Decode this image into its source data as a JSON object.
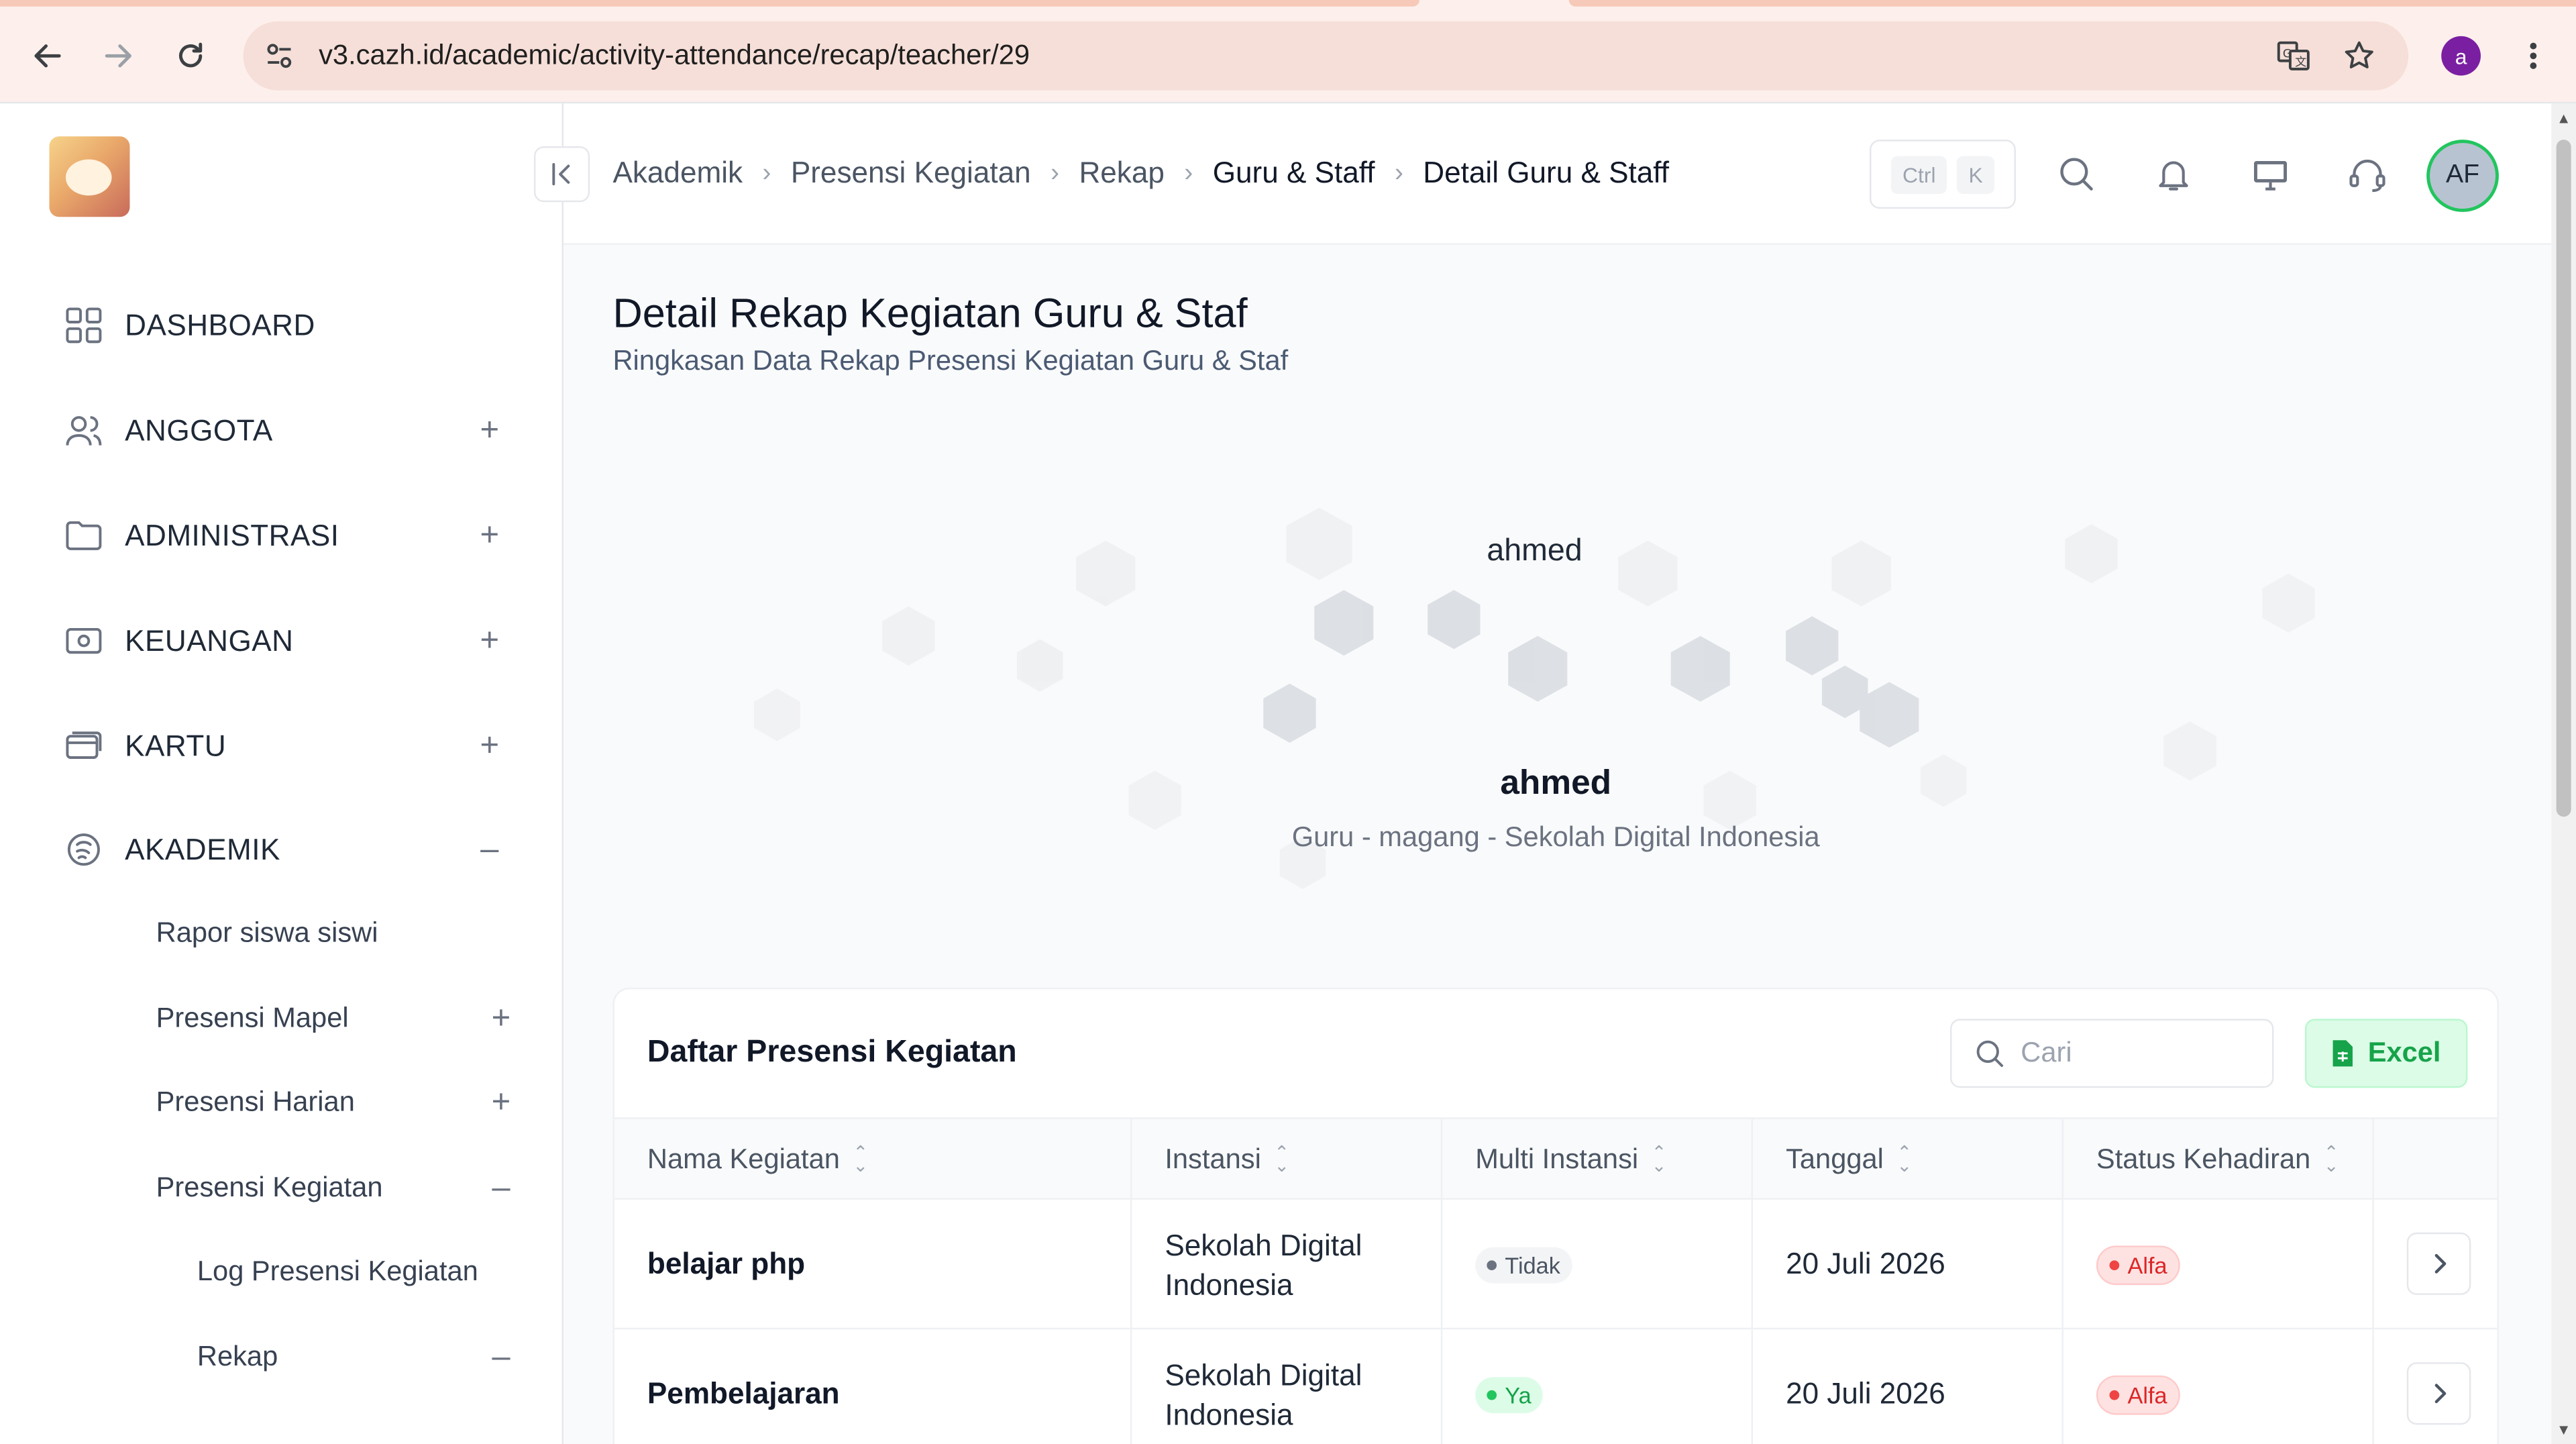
{
  "browser": {
    "url": "v3.cazh.id/academic/activity-attendance/recap/teacher/29",
    "profile_initial": "a"
  },
  "sidebar": {
    "menu": [
      {
        "label": "DASHBOARD",
        "icon": "grid-icon",
        "toggle": ""
      },
      {
        "label": "ANGGOTA",
        "icon": "users-icon",
        "toggle": "+"
      },
      {
        "label": "ADMINISTRASI",
        "icon": "folder-icon",
        "toggle": "+"
      },
      {
        "label": "KEUANGAN",
        "icon": "money-icon",
        "toggle": "+"
      },
      {
        "label": "KARTU",
        "icon": "card-icon",
        "toggle": "+"
      },
      {
        "label": "AKADEMIK",
        "icon": "academic-icon",
        "toggle": "–"
      }
    ],
    "submenu": [
      {
        "label": "Rapor siswa siswi",
        "toggle": ""
      },
      {
        "label": "Presensi Mapel",
        "toggle": "+"
      },
      {
        "label": "Presensi Harian",
        "toggle": "+"
      },
      {
        "label": "Presensi Kegiatan",
        "toggle": "–"
      },
      {
        "label": "Log Presensi Kegiatan",
        "toggle": ""
      },
      {
        "label": "Rekap",
        "toggle": "–"
      }
    ]
  },
  "header": {
    "breadcrumb": [
      "Akademik",
      "Presensi Kegiatan",
      "Rekap",
      "Guru & Staff",
      "Detail Guru & Staff"
    ],
    "kbd": [
      "Ctrl",
      "K"
    ],
    "avatar_initials": "AF"
  },
  "page": {
    "title": "Detail Rekap Kegiatan Guru & Staf",
    "subtitle": "Ringkasan Data Rekap Presensi Kegiatan Guru & Staf"
  },
  "profile": {
    "image_alt": "ahmed",
    "name": "ahmed",
    "role": "Guru - magang - Sekolah Digital Indonesia"
  },
  "table": {
    "title": "Daftar Presensi Kegiatan",
    "search_placeholder": "Cari",
    "excel_label": "Excel",
    "columns": [
      "Nama Kegiatan",
      "Instansi",
      "Multi Instansi",
      "Tanggal",
      "Status Kehadiran"
    ],
    "rows": [
      {
        "name": "belajar php",
        "instansi_line1": "Sekolah Digital",
        "instansi_line2": "Indonesia",
        "multi": "Tidak",
        "multi_color": "grey",
        "tanggal": "20 Juli 2026",
        "status": "Alfa"
      },
      {
        "name": "Pembelajaran",
        "instansi_line1": "Sekolah Digital",
        "instansi_line2": "Indonesia",
        "multi": "Ya",
        "multi_color": "green",
        "tanggal": "20 Juli 2026",
        "status": "Alfa"
      }
    ]
  },
  "colors": {
    "accent_green": "#16a34a",
    "status_red": "#dc2626",
    "avatar_ring": "#22c55e"
  }
}
